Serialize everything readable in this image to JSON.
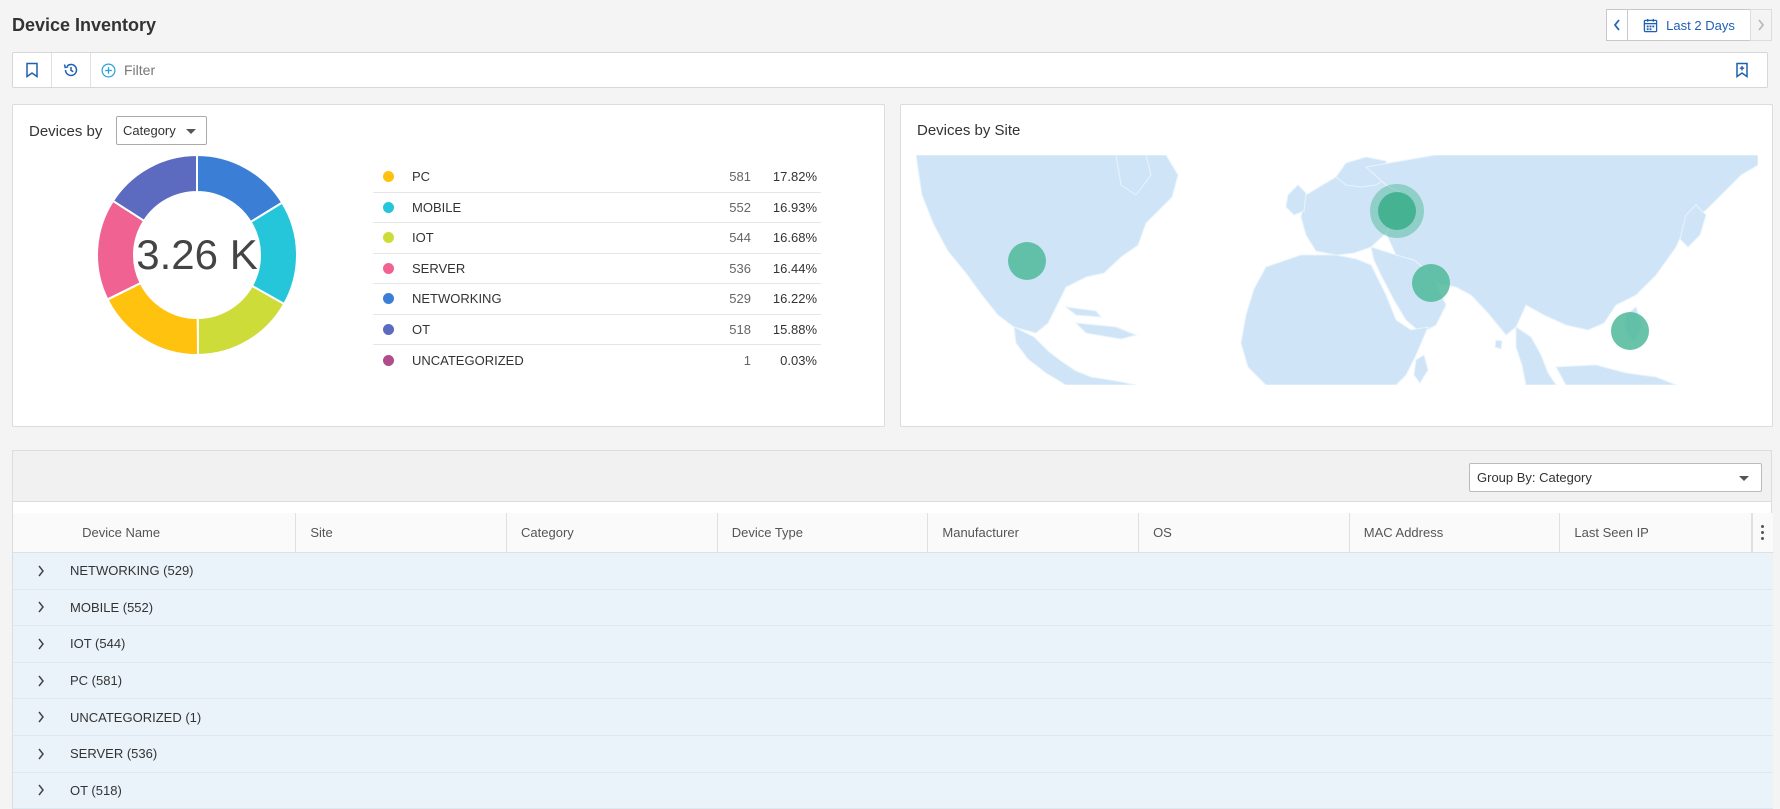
{
  "page": {
    "title": "Device Inventory"
  },
  "date_range": {
    "label": "Last 2 Days"
  },
  "filter": {
    "placeholder": "Filter"
  },
  "category_card": {
    "title": "Devices by",
    "selected": "Category",
    "total_label": "3.26 K",
    "items": [
      {
        "label": "PC",
        "count": "581",
        "pct": "17.82%",
        "color": "#FFC20E"
      },
      {
        "label": "MOBILE",
        "count": "552",
        "pct": "16.93%",
        "color": "#26C6DA"
      },
      {
        "label": "IOT",
        "count": "544",
        "pct": "16.68%",
        "color": "#CDDC39"
      },
      {
        "label": "SERVER",
        "count": "536",
        "pct": "16.44%",
        "color": "#F06292"
      },
      {
        "label": "NETWORKING",
        "count": "529",
        "pct": "16.22%",
        "color": "#3A7FD5"
      },
      {
        "label": "OT",
        "count": "518",
        "pct": "15.88%",
        "color": "#5C6BC0"
      },
      {
        "label": "UNCATEGORIZED",
        "count": "1",
        "pct": "0.03%",
        "color": "#B14C8B"
      }
    ]
  },
  "site_card": {
    "title": "Devices by Site"
  },
  "grid": {
    "group_by": "Group By: Category",
    "columns": [
      "Device Name",
      "Site",
      "Category",
      "Device Type",
      "Manufacturer",
      "OS",
      "MAC Address",
      "Last Seen IP"
    ],
    "groups": [
      "NETWORKING (529)",
      "MOBILE (552)",
      "IOT (544)",
      "PC (581)",
      "UNCATEGORIZED (1)",
      "SERVER (536)",
      "OT (518)"
    ]
  }
}
